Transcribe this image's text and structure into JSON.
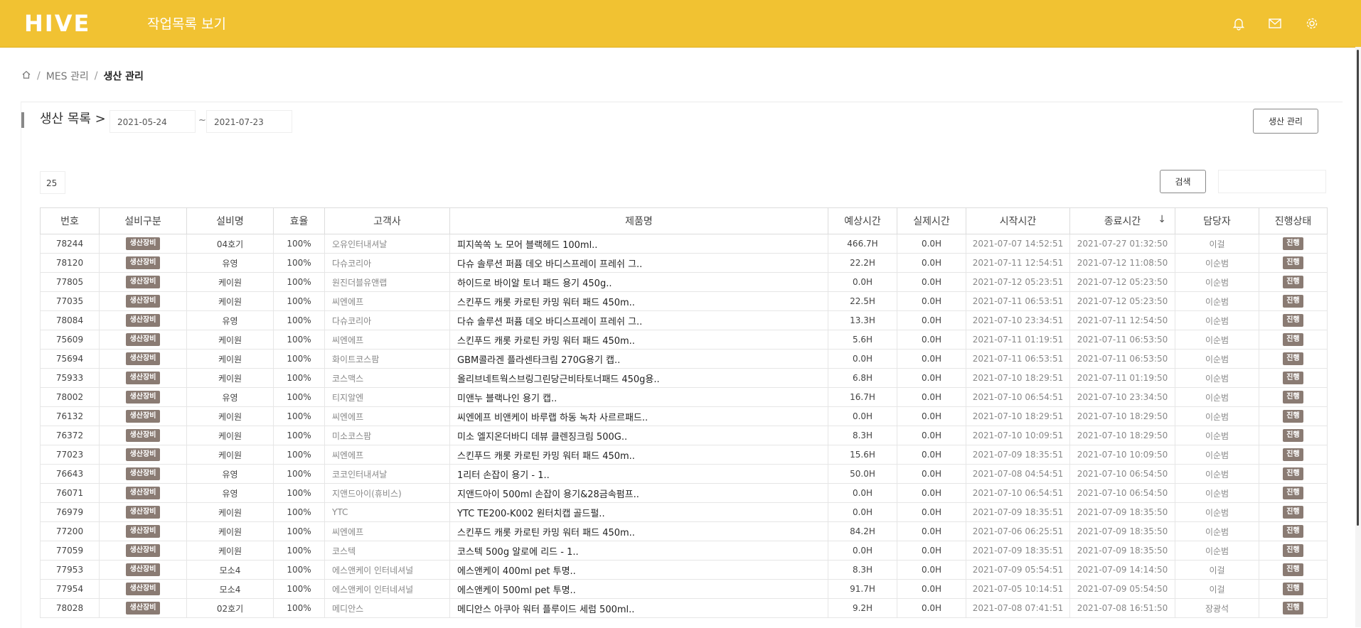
{
  "header": {
    "logo": "HIVE",
    "title": "작업목록 보기",
    "icons": [
      "bell-icon",
      "mail-icon",
      "gear-icon"
    ]
  },
  "breadcrumb": {
    "home_icon": "home-icon",
    "items": [
      "MES 관리",
      "생산 관리"
    ]
  },
  "section": {
    "title": "생산 목록 >",
    "date_from": "2021-05-24",
    "date_separator": "~",
    "date_to": "2021-07-23",
    "manage_button": "생산 관리"
  },
  "toolbar": {
    "page_size": "25",
    "search_button": "검색",
    "search_placeholder": ""
  },
  "table": {
    "columns": [
      "번호",
      "설비구분",
      "설비명",
      "효율",
      "고객사",
      "제품명",
      "예상시간",
      "실제시간",
      "시작시간",
      "종료시간",
      "담당자",
      "진행상태"
    ],
    "sort_indicator": "↓",
    "rows": [
      {
        "no": "78244",
        "type": "생산장비",
        "equip": "04호기",
        "eff": "100%",
        "customer": "오유인터내셔날",
        "product": "피지쏙쏙 노 모어 블랙헤드 100ml..",
        "est": "466.7H",
        "actual": "0.0H",
        "start": "2021-07-07 14:52:51",
        "end": "2021-07-27 01:32:50",
        "manager": "이걸",
        "state": "진행"
      },
      {
        "no": "78120",
        "type": "생산장비",
        "equip": "유영",
        "eff": "100%",
        "customer": "다슈코리아",
        "product": "다슈 솔루션 퍼퓸 데오 바디스프레이 프레쉬 그..",
        "est": "22.2H",
        "actual": "0.0H",
        "start": "2021-07-11 12:54:51",
        "end": "2021-07-12 11:08:50",
        "manager": "이순범",
        "state": "진행"
      },
      {
        "no": "77805",
        "type": "생산장비",
        "equip": "케이원",
        "eff": "100%",
        "customer": "원진더블유앤랩",
        "product": "하이드로 바이알 토너 패드 용기 450g..",
        "est": "0.0H",
        "actual": "0.0H",
        "start": "2021-07-12 05:23:51",
        "end": "2021-07-12 05:23:50",
        "manager": "이순범",
        "state": "진행"
      },
      {
        "no": "77035",
        "type": "생산장비",
        "equip": "케이원",
        "eff": "100%",
        "customer": "씨엔에프",
        "product": "스킨푸드 캐롯 카로틴 카밍 워터 패드 450m..",
        "est": "22.5H",
        "actual": "0.0H",
        "start": "2021-07-11 06:53:51",
        "end": "2021-07-12 05:23:50",
        "manager": "이순범",
        "state": "진행"
      },
      {
        "no": "78084",
        "type": "생산장비",
        "equip": "유영",
        "eff": "100%",
        "customer": "다슈코리아",
        "product": "다슈 솔루션 퍼퓸 데오 바디스프레이 프레쉬 그..",
        "est": "13.3H",
        "actual": "0.0H",
        "start": "2021-07-10 23:34:51",
        "end": "2021-07-11 12:54:50",
        "manager": "이순범",
        "state": "진행"
      },
      {
        "no": "75609",
        "type": "생산장비",
        "equip": "케이원",
        "eff": "100%",
        "customer": "씨엔에프",
        "product": "스킨푸드 캐롯 카로틴 카밍 워터 패드 450m..",
        "est": "5.6H",
        "actual": "0.0H",
        "start": "2021-07-11 01:19:51",
        "end": "2021-07-11 06:53:50",
        "manager": "이순범",
        "state": "진행"
      },
      {
        "no": "75694",
        "type": "생산장비",
        "equip": "케이원",
        "eff": "100%",
        "customer": "화이트코스팜",
        "product": "GBM콜라겐 플라센타크림 270G용기 캡..",
        "est": "0.0H",
        "actual": "0.0H",
        "start": "2021-07-11 06:53:51",
        "end": "2021-07-11 06:53:50",
        "manager": "이순범",
        "state": "진행"
      },
      {
        "no": "75933",
        "type": "생산장비",
        "equip": "케이원",
        "eff": "100%",
        "customer": "코스맥스",
        "product": "올리브네트웍스브링그린당근비타토너패드 450g용..",
        "est": "6.8H",
        "actual": "0.0H",
        "start": "2021-07-10 18:29:51",
        "end": "2021-07-11 01:19:50",
        "manager": "이순범",
        "state": "진행"
      },
      {
        "no": "78002",
        "type": "생산장비",
        "equip": "유영",
        "eff": "100%",
        "customer": "티지알엔",
        "product": "미앤누 블랙나인 용기 캡..",
        "est": "16.7H",
        "actual": "0.0H",
        "start": "2021-07-10 06:54:51",
        "end": "2021-07-10 23:34:50",
        "manager": "이순범",
        "state": "진행"
      },
      {
        "no": "76132",
        "type": "생산장비",
        "equip": "케이원",
        "eff": "100%",
        "customer": "씨엔에프",
        "product": "씨엔에프 비앤케이 바루랩 하동 녹차 사르르패드..",
        "est": "0.0H",
        "actual": "0.0H",
        "start": "2021-07-10 18:29:51",
        "end": "2021-07-10 18:29:50",
        "manager": "이순범",
        "state": "진행"
      },
      {
        "no": "76372",
        "type": "생산장비",
        "equip": "케이원",
        "eff": "100%",
        "customer": "미소코스팜",
        "product": "미소 엘지온더바디 데뷰 클렌징크림 500G..",
        "est": "8.3H",
        "actual": "0.0H",
        "start": "2021-07-10 10:09:51",
        "end": "2021-07-10 18:29:50",
        "manager": "이순범",
        "state": "진행"
      },
      {
        "no": "77023",
        "type": "생산장비",
        "equip": "케이원",
        "eff": "100%",
        "customer": "씨엔에프",
        "product": "스킨푸드 캐롯 카로틴 카밍 워터 패드 450m..",
        "est": "15.6H",
        "actual": "0.0H",
        "start": "2021-07-09 18:35:51",
        "end": "2021-07-10 10:09:50",
        "manager": "이순범",
        "state": "진행"
      },
      {
        "no": "76643",
        "type": "생산장비",
        "equip": "유영",
        "eff": "100%",
        "customer": "코코인터내셔날",
        "product": "1리터 손잡이 용기 - 1..",
        "est": "50.0H",
        "actual": "0.0H",
        "start": "2021-07-08 04:54:51",
        "end": "2021-07-10 06:54:50",
        "manager": "이순범",
        "state": "진행"
      },
      {
        "no": "76071",
        "type": "생산장비",
        "equip": "유영",
        "eff": "100%",
        "customer": "지앤드아이(휴비스)",
        "product": "지앤드아이 500ml 손잡이 용기&28금속펌프..",
        "est": "0.0H",
        "actual": "0.0H",
        "start": "2021-07-10 06:54:51",
        "end": "2021-07-10 06:54:50",
        "manager": "이순범",
        "state": "진행"
      },
      {
        "no": "76979",
        "type": "생산장비",
        "equip": "케이원",
        "eff": "100%",
        "customer": "YTC",
        "product": "YTC TE200-K002 원터치캡 골드펄..",
        "est": "0.0H",
        "actual": "0.0H",
        "start": "2021-07-09 18:35:51",
        "end": "2021-07-09 18:35:50",
        "manager": "이순범",
        "state": "진행"
      },
      {
        "no": "77200",
        "type": "생산장비",
        "equip": "케이원",
        "eff": "100%",
        "customer": "씨엔에프",
        "product": "스킨푸드 캐롯 카로틴 카밍 워터 패드 450m..",
        "est": "84.2H",
        "actual": "0.0H",
        "start": "2021-07-06 06:25:51",
        "end": "2021-07-09 18:35:50",
        "manager": "이순범",
        "state": "진행"
      },
      {
        "no": "77059",
        "type": "생산장비",
        "equip": "케이원",
        "eff": "100%",
        "customer": "코스텍",
        "product": "코스텍 500g 알로에 리드 - 1..",
        "est": "0.0H",
        "actual": "0.0H",
        "start": "2021-07-09 18:35:51",
        "end": "2021-07-09 18:35:50",
        "manager": "이순범",
        "state": "진행"
      },
      {
        "no": "77953",
        "type": "생산장비",
        "equip": "모소4",
        "eff": "100%",
        "customer": "에스앤케이 인터네셔널",
        "product": "에스앤케이 400ml pet 투명..",
        "est": "8.3H",
        "actual": "0.0H",
        "start": "2021-07-09 05:54:51",
        "end": "2021-07-09 14:14:50",
        "manager": "이걸",
        "state": "진행"
      },
      {
        "no": "77954",
        "type": "생산장비",
        "equip": "모소4",
        "eff": "100%",
        "customer": "에스앤케이 인터네셔널",
        "product": "에스앤케이 500ml pet 투명..",
        "est": "91.7H",
        "actual": "0.0H",
        "start": "2021-07-05 10:14:51",
        "end": "2021-07-09 05:54:50",
        "manager": "이걸",
        "state": "진행"
      },
      {
        "no": "78028",
        "type": "생산장비",
        "equip": "02호기",
        "eff": "100%",
        "customer": "메디안스",
        "product": "메디안스 아쿠아 워터 플루이드 세럼 500ml..",
        "est": "9.2H",
        "actual": "0.0H",
        "start": "2021-07-08 07:41:51",
        "end": "2021-07-08 16:51:50",
        "manager": "장광석",
        "state": "진행"
      }
    ]
  },
  "colors": {
    "brand": "#f1c232",
    "badge": "#8a7b73"
  }
}
